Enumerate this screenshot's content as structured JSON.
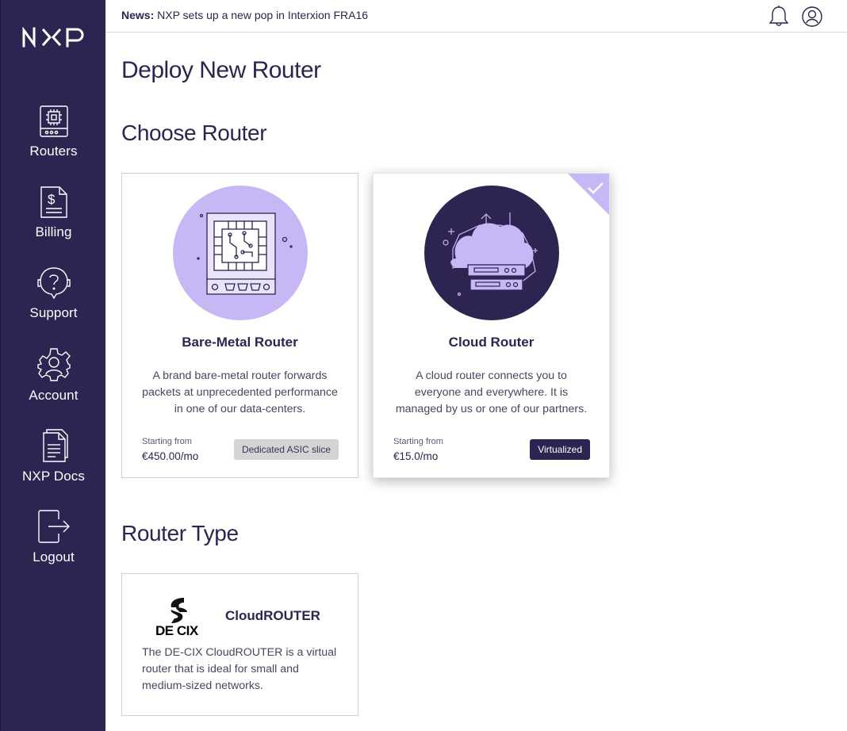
{
  "brand": {
    "logo_text": "NXP"
  },
  "colors": {
    "primary": "#2d2452",
    "accent": "#c7b8f5",
    "white": "#ffffff"
  },
  "sidebar": {
    "items": [
      {
        "label": "Routers",
        "icon": "router-icon"
      },
      {
        "label": "Billing",
        "icon": "invoice-icon"
      },
      {
        "label": "Support",
        "icon": "support-icon"
      },
      {
        "label": "Account",
        "icon": "account-gear-icon"
      },
      {
        "label": "NXP Docs",
        "icon": "docs-icon"
      },
      {
        "label": "Logout",
        "icon": "logout-icon"
      }
    ]
  },
  "topbar": {
    "news_label": "News:",
    "news_text": "NXP sets up a new pop in Interxion FRA16"
  },
  "page": {
    "title": "Deploy New Router",
    "choose_heading": "Choose Router",
    "type_heading": "Router Type"
  },
  "routers": [
    {
      "name": "Bare-Metal Router",
      "description": "A brand bare-metal router forwards packets at unprecedented performance in one of our data-centers.",
      "from_label": "Starting from",
      "price": "€450.00/mo",
      "badge": "Dedicated ASIC slice",
      "selected": false
    },
    {
      "name": "Cloud Router",
      "description": "A cloud router connects you to everyone and everywhere. It is managed by us or one of our partners.",
      "from_label": "Starting from",
      "price": "€15.0/mo",
      "badge": "Virtualized",
      "selected": true
    }
  ],
  "router_types": [
    {
      "logo_text": "DE CIX",
      "name": "CloudROUTER",
      "description": "The DE-CIX CloudROUTER is a virtual router that is ideal for small and medium-sized networks."
    }
  ]
}
